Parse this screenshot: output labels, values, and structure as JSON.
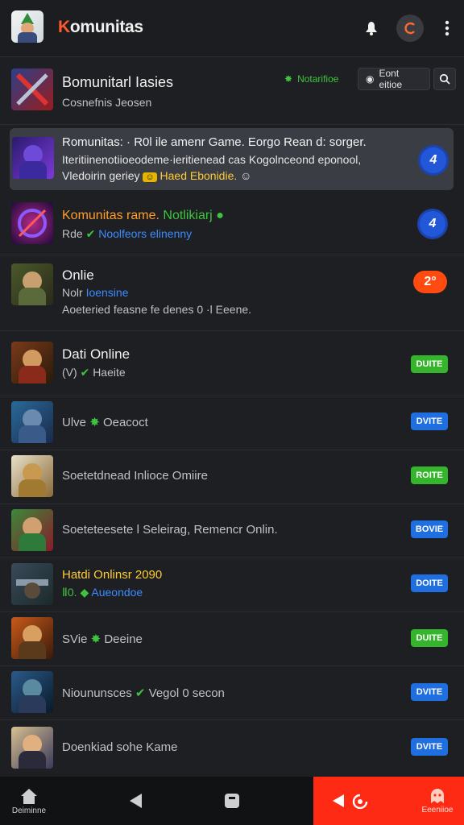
{
  "app": {
    "title_prefix": "K",
    "title_rest": "omunitas",
    "logo_icon": "avatar-logo"
  },
  "header": {
    "title": "Bomunitarl Iasies",
    "subtitle": "Cosnefnis Jeosen",
    "chip1_label": "Notarifioe",
    "chip2_label": "Eont eitioe"
  },
  "rows": [
    {
      "title": "Romunitas: · R0l ile amenr Game. Eorgo Rean d: sorger.",
      "line2": "Iteritiinenotiioeodeme·ieritienead cas Kogolnceond eponool,",
      "line3a": "Vledoirin geriey",
      "line3b": "Haed Ebonidie.",
      "badge": "4"
    },
    {
      "title_a": "Komunitas rame.",
      "title_b": "Notlikiarj",
      "sub_a": "Rde",
      "sub_b": "Noolfeors elinenny",
      "badge": "4"
    },
    {
      "title": "Onlie",
      "sub_a": "Nolr",
      "sub_b": "Ioensine",
      "sub2": "Aoeteried feasne fe denes 0 ·l Eeene.",
      "badge": "2°"
    },
    {
      "title": "Dati Online",
      "sub_a": "(V)",
      "sub_b": "Haeite",
      "btn": "DUITE"
    },
    {
      "title": "Ulve",
      "sub_b": "Oeacoct",
      "btn": "DVITE"
    },
    {
      "title": "Soetetdnead Inlioce Omiire",
      "btn": "ROITE"
    },
    {
      "title": "Soeteteesete l Seleirag, Remencr Onlin.",
      "btn": "BOVIE"
    },
    {
      "title": "Hatdi Onlinsr 2090",
      "sub_a": "Ⅱ0.",
      "sub_b": "Aueondoe",
      "btn": "DOITE"
    },
    {
      "title": "SVie",
      "sub_b": "Deeine",
      "btn": "DUITE"
    },
    {
      "title": "Nioununsces",
      "sub_b": "Vegol 0 secon",
      "btn": "DVITE"
    },
    {
      "title": "Doenkiad sohe Kame",
      "btn": "DVITE"
    }
  ],
  "bottom_nav": {
    "home_label": "Deiminne",
    "right_label": "Eeeniioe"
  },
  "colors": {
    "background": "#1e1f22",
    "highlight_row": "#3b3d44",
    "accent_green": "#35b52b",
    "accent_blue": "#1f6fe0",
    "accent_orange": "#ff4a10",
    "nav_red": "#ff2a14"
  }
}
